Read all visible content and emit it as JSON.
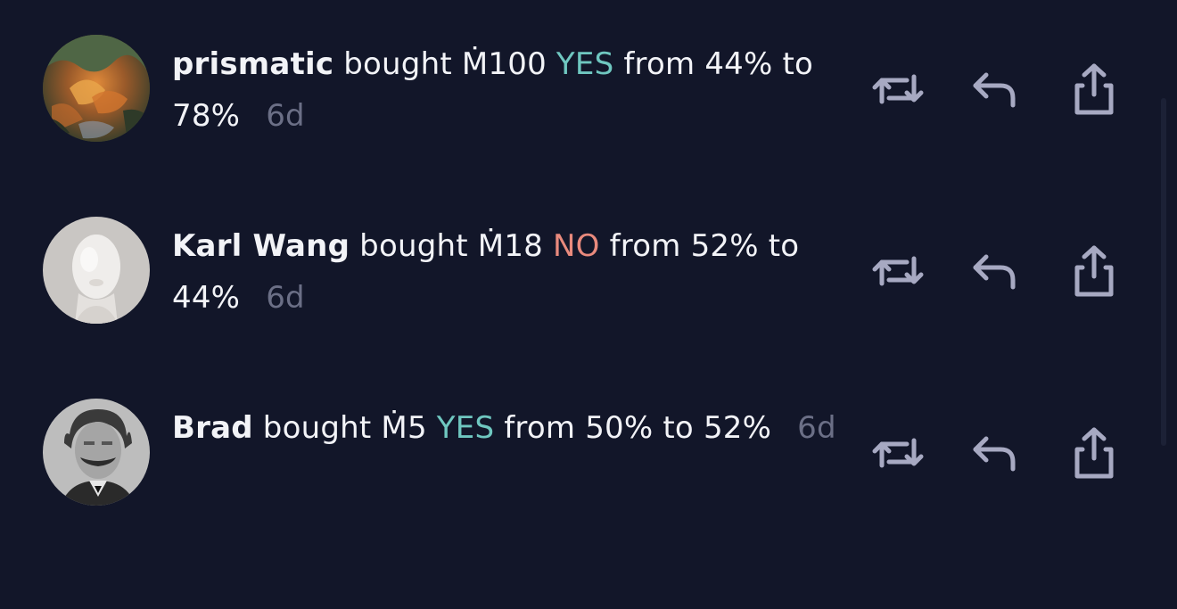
{
  "feed": {
    "items": [
      {
        "user": "prismatic",
        "verb": "bought",
        "amount": "Ṁ100",
        "outcome": "YES",
        "from_word": "from",
        "from_prob": "44%",
        "to_word": "to",
        "to_prob": "78%",
        "time": "6d",
        "avatar_icon": "autumn-landscape-avatar"
      },
      {
        "user": "Karl Wang",
        "verb": "bought",
        "amount": "Ṁ18",
        "outcome": "NO",
        "from_word": "from",
        "from_prob": "52%",
        "to_word": "to",
        "to_prob": "44%",
        "time": "6d",
        "avatar_icon": "white-mannequin-head-avatar"
      },
      {
        "user": "Brad",
        "verb": "bought",
        "amount": "Ṁ5",
        "outcome": "YES",
        "from_word": "from",
        "from_prob": "50%",
        "to_word": "to",
        "to_prob": "52%",
        "time": "6d",
        "avatar_icon": "vintage-portrait-avatar"
      }
    ],
    "actions": [
      "repost-icon",
      "reply-icon",
      "share-icon"
    ]
  },
  "colors": {
    "background": "#121629",
    "text": "#f2f3f7",
    "yes": "#6fc7c0",
    "no": "#e98a7d",
    "muted": "#6b6f86",
    "icon": "#a7a9c2"
  }
}
